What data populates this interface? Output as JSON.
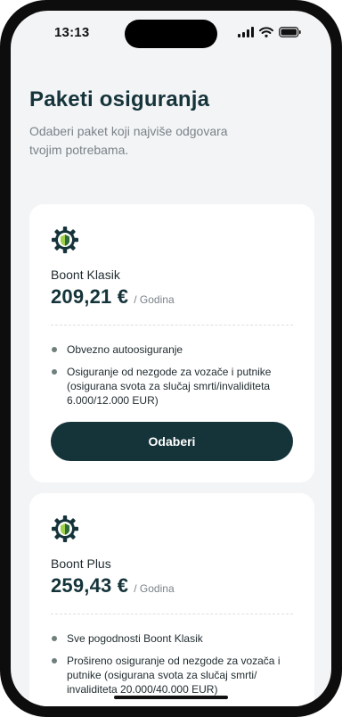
{
  "status_bar": {
    "time": "13:13"
  },
  "header": {
    "title": "Paketi osiguranja",
    "subtitle": "Odaberi paket koji najviše odgovara tvojim potrebama."
  },
  "packages": [
    {
      "icon": "shield-badge-icon",
      "name": "Boont Klasik",
      "price": "209,21 €",
      "period": "/ Godina",
      "features": [
        "Obvezno autoosiguranje",
        "Osiguranje od nezgode za vozače i putnike (osigurana svota za slučaj smrti/invaliditeta 6.000/12.000 EUR)"
      ],
      "button_label": "Odaberi"
    },
    {
      "icon": "shield-badge-icon",
      "name": "Boont Plus",
      "price": "259,43 €",
      "period": "/ Godina",
      "features": [
        "Sve pogodnosti Boont Klasik",
        "Prošireno osiguranje od nezgode za vozača i putnike (osigurana svota za slučaj smrti/ invaliditeta 20.000/40.000 EUR)"
      ]
    }
  ],
  "colors": {
    "brand_dark": "#15343a",
    "accent_green": "#9fd24a",
    "background": "#f3f4f6",
    "muted_text": "#7a8288"
  }
}
